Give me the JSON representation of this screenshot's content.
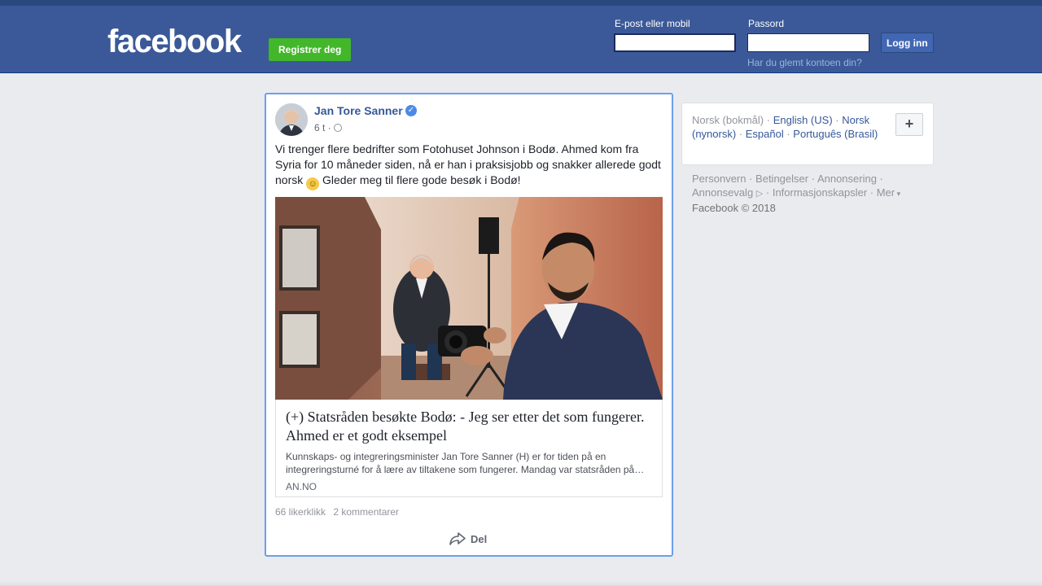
{
  "header": {
    "logo": "facebook",
    "register_label": "Registrer deg",
    "email_label": "E-post eller mobil",
    "password_label": "Passord",
    "email_value": "",
    "password_value": "",
    "login_label": "Logg inn",
    "forgot_label": "Har du glemt kontoen din?"
  },
  "post": {
    "author": "Jan Tore Sanner",
    "time": "6 t ·",
    "text_part1": "Vi trenger flere bedrifter som Fotohuset Johnson i Bodø. Ahmed kom fra Syria for 10 måneder siden, nå er han i praksisjobb og snakker allerede godt norsk",
    "text_part2": "Gleder meg til flere gode besøk i Bodø!",
    "link": {
      "title": "(+) Statsråden besøkte Bodø: - Jeg ser etter det som fungerer. Ahmed er et godt eksempel",
      "description": "Kunnskaps- og integreringsminister Jan Tore Sanner (H) er for tiden på en integreringsturné for å lære av tiltakene som fungerer. Mandag var statsråden på…",
      "source": "AN.NO"
    },
    "likes": "66 likerklikk",
    "comments": "2 kommentarer",
    "share_label": "Del"
  },
  "languages": {
    "current": "Norsk (bokmål)",
    "items": [
      "English (US)",
      "Norsk (nynorsk)",
      "Español",
      "Português (Brasil)"
    ],
    "plus_label": "+"
  },
  "footer": {
    "links": [
      "Personvern",
      "Betingelser",
      "Annonsering",
      "Annonsevalg",
      "Informasjonskapsler",
      "Mer"
    ],
    "copyright": "Facebook © 2018"
  },
  "colors": {
    "header_bg": "#3b5998",
    "register_green": "#42b72a",
    "link_blue": "#365899",
    "post_focus_border": "#6d9eeb"
  }
}
